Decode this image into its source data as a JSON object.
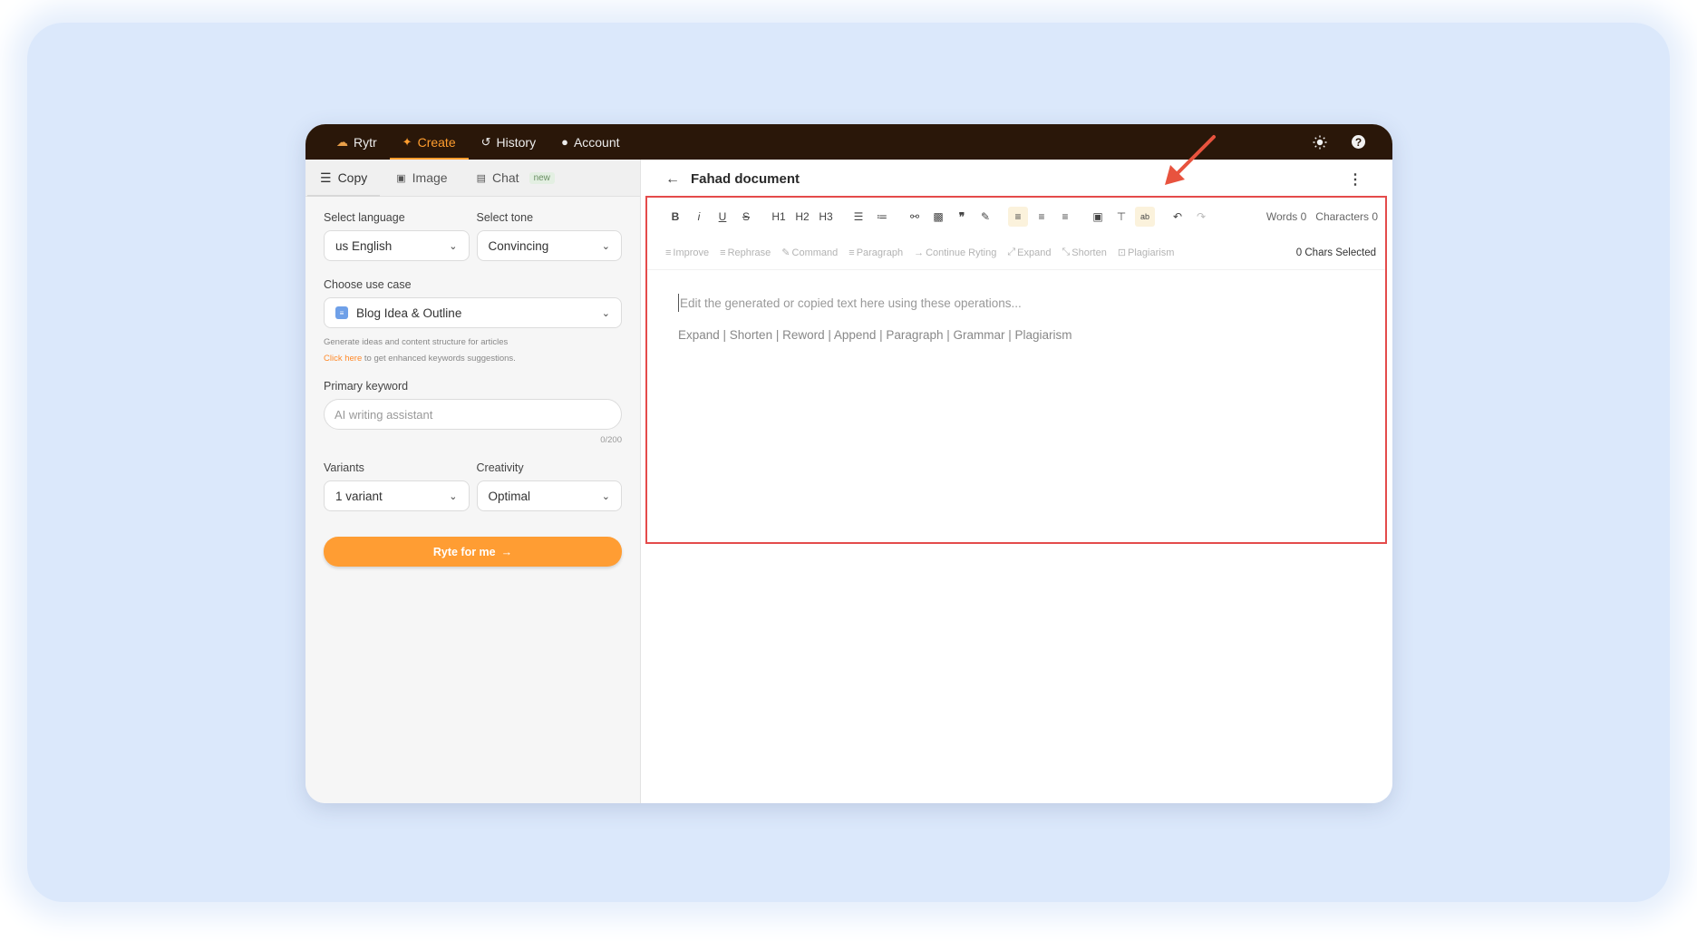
{
  "nav": {
    "logo": "Rytr",
    "items": [
      {
        "label": "Create",
        "icon": "sparkle-icon"
      },
      {
        "label": "History",
        "icon": "history-icon"
      },
      {
        "label": "Account",
        "icon": "user-icon"
      }
    ]
  },
  "sidebar": {
    "tabs": [
      {
        "label": "Copy",
        "icon": "list-icon"
      },
      {
        "label": "Image",
        "icon": "image-icon"
      },
      {
        "label": "Chat",
        "icon": "chat-icon",
        "badge": "new"
      }
    ],
    "language_label": "Select language",
    "language_value": "us English",
    "tone_label": "Select tone",
    "tone_value": "Convincing",
    "usecase_label": "Choose use case",
    "usecase_value": "Blog Idea & Outline",
    "usecase_hint": "Generate ideas and content structure for articles",
    "click_here": "Click here",
    "click_here_rest": "to get enhanced keywords suggestions.",
    "keyword_label": "Primary keyword",
    "keyword_placeholder": "AI writing assistant",
    "keyword_counter": "0/200",
    "variants_label": "Variants",
    "variants_value": "1 variant",
    "creativity_label": "Creativity",
    "creativity_value": "Optimal",
    "cta_label": "Ryte for me"
  },
  "editor": {
    "title": "Fahad document",
    "toolbar": [
      "B",
      "i",
      "U",
      "S",
      "H1",
      "H2",
      "H3"
    ],
    "words": "Words 0",
    "characters": "Characters 0",
    "actions": [
      "Improve",
      "Rephrase",
      "Command",
      "Paragraph",
      "Continue Ryting",
      "Expand",
      "Shorten",
      "Plagiarism"
    ],
    "chars_selected": "0 Chars Selected",
    "placeholder": "Edit the generated or copied text here using these operations...",
    "operations": "Expand | Shorten | Reword | Append | Paragraph | Grammar | Plagiarism"
  },
  "colors": {
    "topbar": "#2a1709",
    "accent": "#ff9d33",
    "annotation": "#e44b4b"
  }
}
